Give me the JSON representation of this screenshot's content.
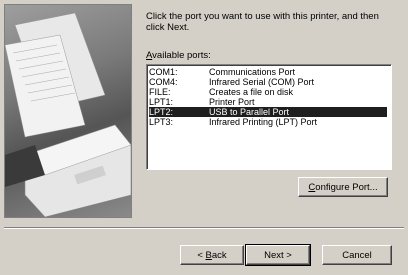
{
  "instruction": "Click the port you want to use with this printer, and then click Next.",
  "ports_label_prefix": "A",
  "ports_label_rest": "vailable ports:",
  "ports": [
    {
      "port": "COM1:",
      "description": "Communications Port"
    },
    {
      "port": "COM4:",
      "description": "Infrared Serial (COM) Port"
    },
    {
      "port": "FILE:",
      "description": "Creates a file on disk"
    },
    {
      "port": "LPT1:",
      "description": "Printer Port"
    },
    {
      "port": "LPT2:",
      "description": "USB to Parallel Port",
      "selected": true
    },
    {
      "port": "LPT3:",
      "description": "Infrared Printing (LPT) Port"
    }
  ],
  "buttons": {
    "configure_prefix": "C",
    "configure_rest": "onfigure Port...",
    "back_prefix": "< ",
    "back_mnemonic": "B",
    "back_rest": "ack",
    "next": "Next >",
    "cancel": "Cancel"
  },
  "colors": {
    "dialog_bg": "#d4d0c8",
    "selection_bg": "#1e1e1e",
    "selection_text": "#ffffff"
  }
}
